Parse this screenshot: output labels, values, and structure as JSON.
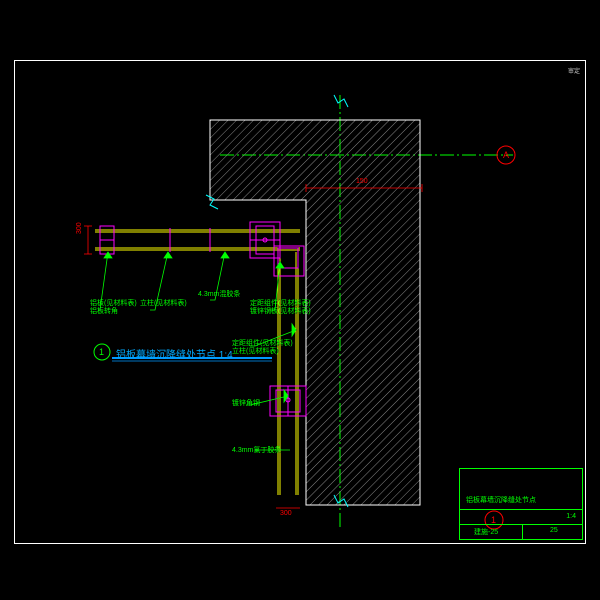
{
  "drawing": {
    "title_text": "铝板幕墙沉降缝处节点",
    "title_scale": "1:4",
    "title_number": "1",
    "axis_label_a": "A",
    "axis_label_1": "1",
    "dims": {
      "d1": "300",
      "d2": "150"
    },
    "annotations": {
      "a1_l1": "铝板(见材料表)",
      "a1_l2": "铝板转角",
      "a2": "立柱(见材料表)",
      "a3": "4.3mm混胶条",
      "a4_l1": "定距组件(见材料表)",
      "a4_l2": "镀锌钢板(见材料表)",
      "a5_l1": "定距组件(见材料表)",
      "a5_l2": "立柱(见材料表)",
      "a6": "镀锌角钢",
      "a7": "4.3mm氯丁胶条"
    },
    "titleblock": {
      "line1": "铝板幕墙沉降缝处节点",
      "scale_lbl": "1:4",
      "sheet_a": "建施-25",
      "sheet_b": "25"
    },
    "border_text": "审定"
  }
}
